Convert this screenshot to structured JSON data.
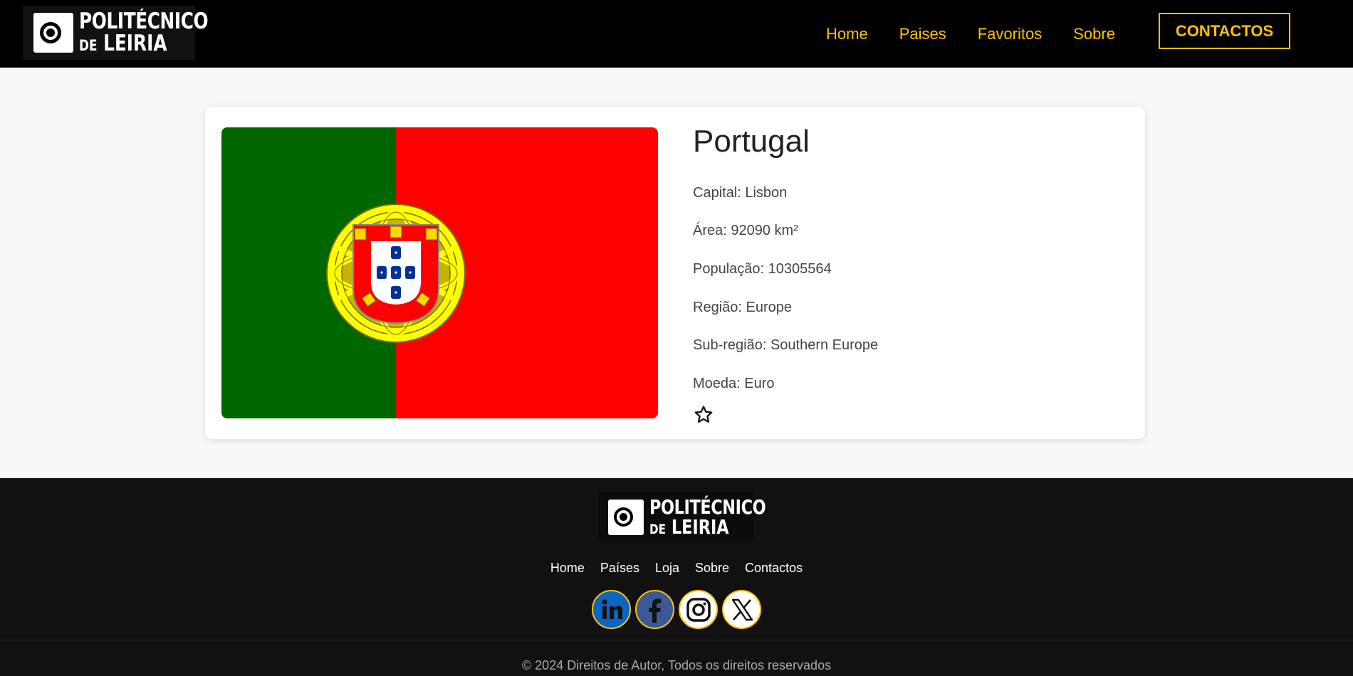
{
  "header": {
    "logo": {
      "line1": "POLITÉCNICO",
      "line2_prefix": "DE",
      "line2": "LEIRIA"
    },
    "nav": [
      "Home",
      "Paises",
      "Favoritos",
      "Sobre"
    ],
    "contact_label": "CONTACTOS"
  },
  "country": {
    "name": "Portugal",
    "capital": "Capital: Lisbon",
    "area": "Área: 92090 km²",
    "population": "População: 10305564",
    "region": "Região: Europe",
    "subregion": "Sub-região: Southern Europe",
    "currency": "Moeda: Euro",
    "favorite": false
  },
  "footer": {
    "logo": {
      "line1": "POLITÉCNICO",
      "line2_prefix": "DE",
      "line2": "LEIRIA"
    },
    "links": [
      "Home",
      "Países",
      "Loja",
      "Sobre",
      "Contactos"
    ],
    "socials": [
      "linkedin-icon",
      "facebook-icon",
      "instagram-icon",
      "x-icon"
    ],
    "copyright": "© 2024 Direitos de Autor, Todos os direitos reservados"
  },
  "colors": {
    "accent": "#ffc107",
    "header_bg": "#000000",
    "footer_bg": "#111111",
    "flag_green": "#006600",
    "flag_red": "#ff0000"
  }
}
